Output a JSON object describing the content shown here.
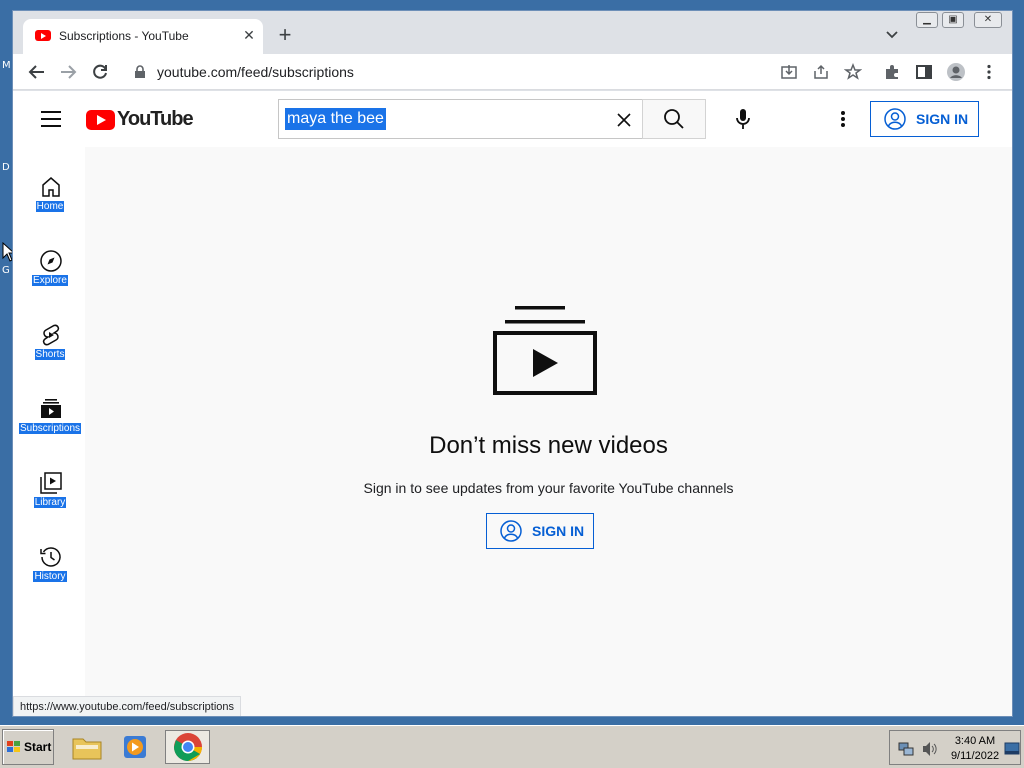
{
  "desktop": {
    "fragment1": "M",
    "fragment2": "D",
    "fragment3": "G"
  },
  "browser": {
    "tab_title": "Subscriptions - YouTube",
    "url": "youtube.com/feed/subscriptions",
    "status_url": "https://www.youtube.com/feed/subscriptions"
  },
  "youtube": {
    "logo_text": "YouTube",
    "search_value": "maya the bee",
    "signin_label": "SIGN IN",
    "guide": [
      {
        "label": "Home",
        "icon": "home-icon"
      },
      {
        "label": "Explore",
        "icon": "compass-icon"
      },
      {
        "label": "Shorts",
        "icon": "shorts-icon"
      },
      {
        "label": "Subscriptions",
        "icon": "subscriptions-icon"
      },
      {
        "label": "Library",
        "icon": "library-icon"
      },
      {
        "label": "History",
        "icon": "history-icon"
      }
    ],
    "empty_title": "Don’t miss new videos",
    "empty_subtitle": "Sign in to see updates from your favorite YouTube channels",
    "empty_signin_label": "SIGN IN"
  },
  "taskbar": {
    "start_label": "Start",
    "time": "3:40 AM",
    "date": "9/11/2022"
  }
}
